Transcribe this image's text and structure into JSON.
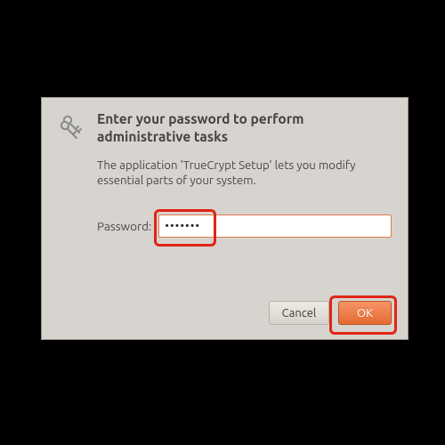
{
  "dialog": {
    "title": "Enter your password to perform administrative tasks",
    "message": "The application 'TrueCrypt Setup' lets you modify essential parts of your system.",
    "password_label": "Password:",
    "password_value": "•••••••",
    "buttons": {
      "cancel": "Cancel",
      "ok": "OK"
    },
    "icon": "keys-icon",
    "accent_color": "#e56a33",
    "highlight_color": "#e02514"
  }
}
